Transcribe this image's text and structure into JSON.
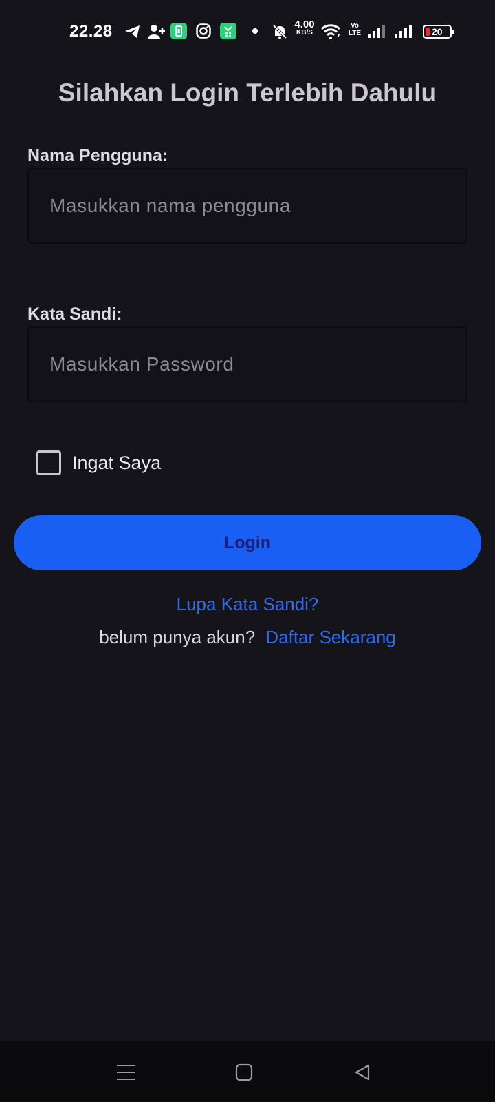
{
  "status_bar": {
    "time": "22.28",
    "net_speed_value": "4.00",
    "net_speed_unit": "KB/S",
    "volte_top": "Vo",
    "volte_bottom": "LTE",
    "battery_level": "20",
    "battery_color": "#ef2b3c",
    "icons": [
      "telegram-icon",
      "add-contact-icon",
      "battery-saver-app-icon",
      "instagram-icon",
      "green-app-icon",
      "dot-icon",
      "silent-bell-icon",
      "wifi-icon",
      "signal-1-icon",
      "signal-2-icon"
    ]
  },
  "login": {
    "title": "Silahkan Login Terlebih Dahulu",
    "username_label": "Nama Pengguna:",
    "username_placeholder": "Masukkan nama pengguna",
    "password_label": "Kata Sandi:",
    "password_placeholder": "Masukkan Password",
    "remember_label": "Ingat Saya",
    "remember_checked": false,
    "button_label": "Login",
    "forgot_label": "Lupa Kata Sandi?",
    "register_prompt": "belum punya akun?",
    "register_link": "Daftar Sekarang"
  },
  "nav_bar": {
    "buttons": [
      "recents-menu-icon",
      "home-square-icon",
      "back-triangle-icon"
    ]
  },
  "colors": {
    "background": "#16141b",
    "accent": "#1a5ff4",
    "link": "#2d6bef",
    "button_text": "#241e72"
  }
}
